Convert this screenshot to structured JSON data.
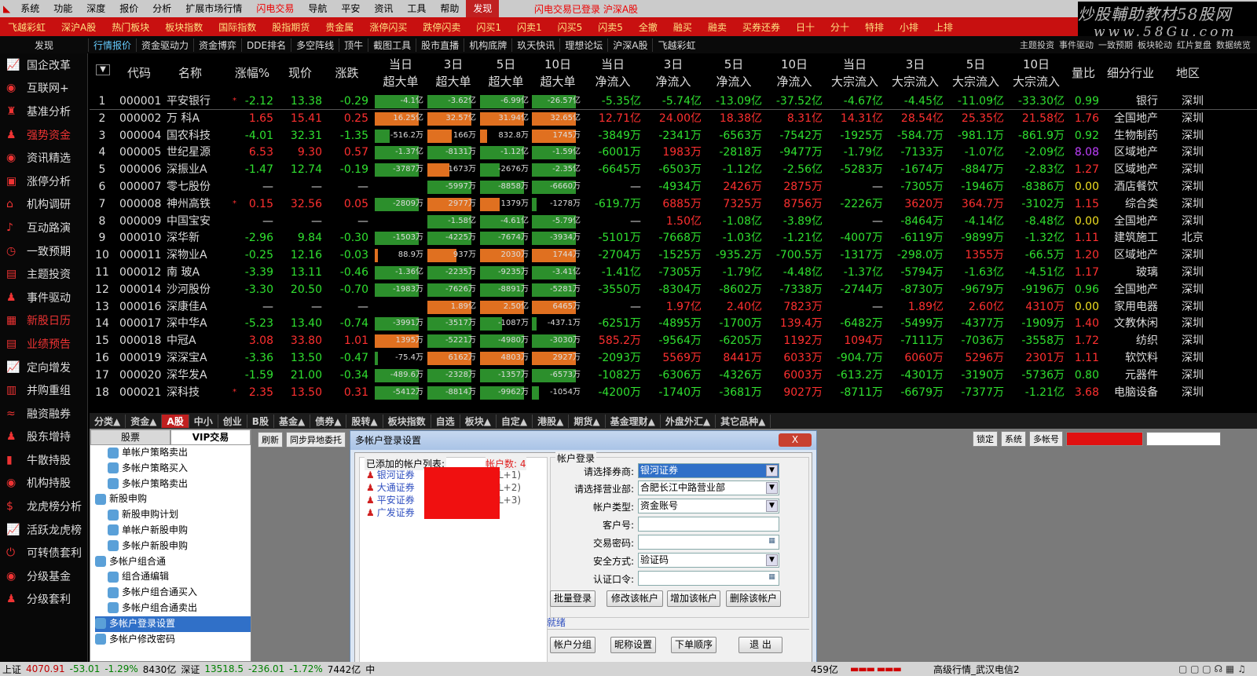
{
  "menu": [
    "系统",
    "功能",
    "深度",
    "报价",
    "分析",
    "扩展市场行情",
    "闪电交易",
    "导航",
    "平安",
    "资讯",
    "工具",
    "帮助",
    "发现"
  ],
  "menu_center": "闪电交易已登录  沪深A股",
  "logo": {
    "line1": "炒股輔助教材58股网",
    "line2": "www.58Gu.com"
  },
  "redbar": [
    "飞越彩虹",
    "深沪A股",
    "热门板块",
    "板块指数",
    "国际指数",
    "股指期货",
    "贵金属",
    "涨停闪买",
    "跌停闪卖",
    "闪买1",
    "闪卖1",
    "闪买5",
    "闪卖5",
    "全撤",
    "融买",
    "融卖",
    "买券还券",
    "日十",
    "分十",
    "特排",
    "小排",
    "上排"
  ],
  "subtab_first": "发现",
  "subtabs": [
    "行情报价",
    "资金驱动力",
    "资金博弈",
    "DDE排名",
    "多空阵线",
    "顶牛",
    "截图工具",
    "股市直播",
    "机构底牌",
    "玖天快讯",
    "理想论坛",
    "沪深A股",
    "飞越彩虹"
  ],
  "subtabs_right": [
    "主题投资",
    "事件驱动",
    "一致预期",
    "板块轮动",
    "红片复盘",
    "数据统览"
  ],
  "sidebar": [
    "国企改革",
    "互联网+",
    "基准分析",
    "强势资金",
    "资讯精选",
    "涨停分析",
    "机构调研",
    "互动路演",
    "一致预期",
    "主题投资",
    "事件驱动",
    "新股日历",
    "业绩预告",
    "定向增发",
    "并购重组",
    "融资融券",
    "股东增持",
    "牛散持股",
    "机构持股",
    "龙虎榜分析",
    "活跃龙虎榜",
    "可转债套利",
    "分级基金",
    "分级套利"
  ],
  "sidebar_icons": [
    "chart-icon",
    "globe-icon",
    "bell-icon",
    "person-icon",
    "globe-icon",
    "window-icon",
    "bank-icon",
    "mic-icon",
    "clock-icon",
    "doc-icon",
    "person-icon",
    "calendar-icon",
    "doc-icon",
    "chart-icon",
    "grid-icon",
    "wave-icon",
    "person-icon",
    "bars-icon",
    "globe-icon",
    "dollar-icon",
    "chart-icon",
    "power-icon",
    "globe-icon",
    "person-icon"
  ],
  "headers": {
    "code": "代码",
    "name": "名称",
    "pct": "涨幅%",
    "price": "现价",
    "chg": "涨跌",
    "h1a": "当日",
    "h1b": "超大单",
    "h2a": "3日",
    "h2b": "超大单",
    "h3a": "5日",
    "h3b": "超大单",
    "h4a": "10日",
    "h4b": "超大单",
    "h5a": "当日",
    "h5b": "净流入",
    "h6a": "3日",
    "h6b": "净流入",
    "h7a": "5日",
    "h7b": "净流入",
    "h8a": "10日",
    "h8b": "净流入",
    "h9a": "当日",
    "h9b": "大宗流入",
    "h10a": "3日",
    "h10b": "大宗流入",
    "h11a": "5日",
    "h11b": "大宗流入",
    "h12a": "10日",
    "h12b": "大宗流入",
    "lb": "量比",
    "ind": "细分行业",
    "reg": "地区"
  },
  "rows": [
    {
      "n": "1",
      "code": "000001",
      "name": "平安银行",
      "mark": "*",
      "pct": "-2.12",
      "price": "13.38",
      "chg": "-0.29",
      "b": [
        [
          "g",
          "-4.1亿",
          0.9
        ],
        [
          "g",
          "-3.62亿",
          0.9
        ],
        [
          "g",
          "-6.99亿",
          0.9
        ],
        [
          "g",
          "-26.57亿",
          0.9
        ]
      ],
      "f": [
        "-5.35亿",
        "-5.74亿",
        "-13.09亿",
        "-37.52亿",
        "-4.67亿",
        "-4.45亿",
        "-11.09亿",
        "-33.30亿"
      ],
      "lb": "0.99",
      "ind": "银行",
      "reg": "深圳"
    },
    {
      "n": "2",
      "code": "000002",
      "name": "万 科A",
      "mark": "",
      "pct": "1.65",
      "price": "15.41",
      "chg": "0.25",
      "b": [
        [
          "o",
          "16.25亿",
          0.9
        ],
        [
          "o",
          "32.57亿",
          0.9
        ],
        [
          "o",
          "31.94亿",
          0.9
        ],
        [
          "o",
          "32.65亿",
          0.9
        ]
      ],
      "f": [
        "12.71亿",
        "24.00亿",
        "18.38亿",
        "8.31亿",
        "14.31亿",
        "28.54亿",
        "25.35亿",
        "21.58亿"
      ],
      "lb": "1.76",
      "ind": "全国地产",
      "reg": "深圳"
    },
    {
      "n": "3",
      "code": "000004",
      "name": "国农科技",
      "mark": "",
      "pct": "-4.01",
      "price": "32.31",
      "chg": "-1.35",
      "b": [
        [
          "g",
          "-516.2万",
          0.3
        ],
        [
          "o",
          "166万",
          0.5
        ],
        [
          "o",
          "832.8万",
          0.15
        ],
        [
          "o",
          "1745万",
          0.9
        ]
      ],
      "f": [
        "-3849万",
        "-2341万",
        "-6563万",
        "-7542万",
        "-1925万",
        "-584.7万",
        "-981.1万",
        "-861.9万"
      ],
      "lb": "0.92",
      "ind": "生物制药",
      "reg": "深圳"
    },
    {
      "n": "4",
      "code": "000005",
      "name": "世纪星源",
      "mark": "",
      "pct": "6.53",
      "price": "9.30",
      "chg": "0.57",
      "b": [
        [
          "g",
          "-1.37亿",
          0.9
        ],
        [
          "g",
          "-8131万",
          0.9
        ],
        [
          "g",
          "-1.12亿",
          0.9
        ],
        [
          "g",
          "-1.59亿",
          0.9
        ]
      ],
      "f": [
        "-6001万",
        "1983万",
        "-2818万",
        "-9477万",
        "-1.79亿",
        "-7133万",
        "-1.07亿",
        "-2.09亿"
      ],
      "lb": "8.08",
      "ind": "区域地产",
      "reg": "深圳"
    },
    {
      "n": "5",
      "code": "000006",
      "name": "深振业A",
      "mark": "",
      "pct": "-1.47",
      "price": "12.74",
      "chg": "-0.19",
      "b": [
        [
          "g",
          "-3787万",
          0.9
        ],
        [
          "o",
          "1673万",
          0.45
        ],
        [
          "g",
          "-2676万",
          0.4
        ],
        [
          "g",
          "-2.35亿",
          0.9
        ]
      ],
      "f": [
        "-6645万",
        "-6503万",
        "-1.12亿",
        "-2.56亿",
        "-5283万",
        "-1674万",
        "-8847万",
        "-2.83亿"
      ],
      "lb": "1.27",
      "ind": "区域地产",
      "reg": "深圳"
    },
    {
      "n": "6",
      "code": "000007",
      "name": "零七股份",
      "mark": "",
      "pct": "—",
      "price": "—",
      "chg": "—",
      "b": [
        [
          "n",
          "",
          0
        ],
        [
          "g",
          "-5997万",
          0.9
        ],
        [
          "g",
          "-8858万",
          0.9
        ],
        [
          "g",
          "-6660万",
          0.9
        ]
      ],
      "f": [
        "—",
        "-4934万",
        "2426万",
        "2875万",
        "—",
        "-7305万",
        "-1946万",
        "-8386万"
      ],
      "lb": "0.00",
      "ind": "酒店餐饮",
      "reg": "深圳"
    },
    {
      "n": "7",
      "code": "000008",
      "name": "神州高铁",
      "mark": "*",
      "pct": "0.15",
      "price": "32.56",
      "chg": "0.05",
      "b": [
        [
          "g",
          "-2809万",
          0.9
        ],
        [
          "o",
          "2977万",
          0.9
        ],
        [
          "o",
          "1379万",
          0.4
        ],
        [
          "g",
          "-1278万",
          0.1
        ]
      ],
      "f": [
        "-619.7万",
        "6885万",
        "7325万",
        "8756万",
        "-2226万",
        "3620万",
        "364.7万",
        "-3102万"
      ],
      "lb": "1.15",
      "ind": "综合类",
      "reg": "深圳"
    },
    {
      "n": "8",
      "code": "000009",
      "name": "中国宝安",
      "mark": "",
      "pct": "—",
      "price": "—",
      "chg": "—",
      "b": [
        [
          "n",
          "",
          0
        ],
        [
          "g",
          "-1.58亿",
          0.9
        ],
        [
          "g",
          "-4.61亿",
          0.9
        ],
        [
          "g",
          "-5.79亿",
          0.9
        ]
      ],
      "f": [
        "—",
        "1.50亿",
        "-1.08亿",
        "-3.89亿",
        "—",
        "-8464万",
        "-4.14亿",
        "-8.48亿"
      ],
      "lb": "0.00",
      "ind": "全国地产",
      "reg": "深圳"
    },
    {
      "n": "9",
      "code": "000010",
      "name": "深华新",
      "mark": "",
      "pct": "-2.96",
      "price": "9.84",
      "chg": "-0.30",
      "b": [
        [
          "g",
          "-1503万",
          0.9
        ],
        [
          "g",
          "-4225万",
          0.9
        ],
        [
          "g",
          "-7674万",
          0.9
        ],
        [
          "g",
          "-3934万",
          0.9
        ]
      ],
      "f": [
        "-5101万",
        "-7668万",
        "-1.03亿",
        "-1.21亿",
        "-4007万",
        "-6119万",
        "-9899万",
        "-1.32亿"
      ],
      "lb": "1.11",
      "ind": "建筑施工",
      "reg": "北京"
    },
    {
      "n": "10",
      "code": "000011",
      "name": "深物业A",
      "mark": "",
      "pct": "-0.25",
      "price": "12.16",
      "chg": "-0.03",
      "b": [
        [
          "o",
          "88.9万",
          0.06
        ],
        [
          "o",
          "937万",
          0.6
        ],
        [
          "o",
          "2030万",
          0.9
        ],
        [
          "o",
          "1744万",
          0.9
        ]
      ],
      "f": [
        "-2704万",
        "-1525万",
        "-935.2万",
        "-700.5万",
        "-1317万",
        "-298.0万",
        "1355万",
        "-66.5万"
      ],
      "lb": "1.20",
      "ind": "区域地产",
      "reg": "深圳"
    },
    {
      "n": "11",
      "code": "000012",
      "name": "南 玻A",
      "mark": "",
      "pct": "-3.39",
      "price": "13.11",
      "chg": "-0.46",
      "b": [
        [
          "g",
          "-1.36亿",
          0.9
        ],
        [
          "g",
          "-2235万",
          0.9
        ],
        [
          "g",
          "-9235万",
          0.9
        ],
        [
          "g",
          "-3.41亿",
          0.9
        ]
      ],
      "f": [
        "-1.41亿",
        "-7305万",
        "-1.79亿",
        "-4.48亿",
        "-1.37亿",
        "-5794万",
        "-1.63亿",
        "-4.51亿"
      ],
      "lb": "1.17",
      "ind": "玻璃",
      "reg": "深圳"
    },
    {
      "n": "12",
      "code": "000014",
      "name": "沙河股份",
      "mark": "",
      "pct": "-3.30",
      "price": "20.50",
      "chg": "-0.70",
      "b": [
        [
          "g",
          "-1983万",
          0.9
        ],
        [
          "g",
          "-7626万",
          0.9
        ],
        [
          "g",
          "-8891万",
          0.9
        ],
        [
          "g",
          "-5281万",
          0.9
        ]
      ],
      "f": [
        "-3550万",
        "-8304万",
        "-8602万",
        "-7338万",
        "-2744万",
        "-8730万",
        "-9679万",
        "-9196万"
      ],
      "lb": "0.96",
      "ind": "全国地产",
      "reg": "深圳"
    },
    {
      "n": "13",
      "code": "000016",
      "name": "深康佳A",
      "mark": "",
      "pct": "—",
      "price": "—",
      "chg": "—",
      "b": [
        [
          "n",
          "",
          0
        ],
        [
          "o",
          "1.89亿",
          0.9
        ],
        [
          "o",
          "2.50亿",
          0.9
        ],
        [
          "o",
          "6465万",
          0.9
        ]
      ],
      "f": [
        "—",
        "1.97亿",
        "2.40亿",
        "7823万",
        "—",
        "1.89亿",
        "2.60亿",
        "4310万"
      ],
      "lb": "0.00",
      "ind": "家用电器",
      "reg": "深圳"
    },
    {
      "n": "14",
      "code": "000017",
      "name": "深中华A",
      "mark": "",
      "pct": "-5.23",
      "price": "13.40",
      "chg": "-0.74",
      "b": [
        [
          "g",
          "-3991万",
          0.9
        ],
        [
          "g",
          "-3517万",
          0.9
        ],
        [
          "g",
          "-1087万",
          0.45
        ],
        [
          "g",
          "-437.1万",
          0.1
        ]
      ],
      "f": [
        "-6251万",
        "-4895万",
        "-1700万",
        "139.4万",
        "-6482万",
        "-5499万",
        "-4377万",
        "-1909万"
      ],
      "lb": "1.40",
      "ind": "文教休闲",
      "reg": "深圳"
    },
    {
      "n": "15",
      "code": "000018",
      "name": "中冠A",
      "mark": "",
      "pct": "3.08",
      "price": "33.80",
      "chg": "1.01",
      "b": [
        [
          "o",
          "1395万",
          0.9
        ],
        [
          "g",
          "-5221万",
          0.9
        ],
        [
          "g",
          "-4980万",
          0.9
        ],
        [
          "g",
          "-3030万",
          0.9
        ]
      ],
      "f": [
        "585.2万",
        "-9564万",
        "-6205万",
        "1192万",
        "1094万",
        "-7111万",
        "-7036万",
        "-3558万"
      ],
      "lb": "1.72",
      "ind": "纺织",
      "reg": "深圳"
    },
    {
      "n": "16",
      "code": "000019",
      "name": "深深宝A",
      "mark": "",
      "pct": "-3.36",
      "price": "13.50",
      "chg": "-0.47",
      "b": [
        [
          "g",
          "-75.4万",
          0.05
        ],
        [
          "o",
          "6162万",
          0.9
        ],
        [
          "o",
          "4803万",
          0.9
        ],
        [
          "o",
          "2927万",
          0.9
        ]
      ],
      "f": [
        "-2093万",
        "5569万",
        "8441万",
        "6033万",
        "-904.7万",
        "6060万",
        "5296万",
        "2301万"
      ],
      "lb": "1.11",
      "ind": "软饮料",
      "reg": "深圳"
    },
    {
      "n": "17",
      "code": "000020",
      "name": "深华发A",
      "mark": "",
      "pct": "-1.59",
      "price": "21.00",
      "chg": "-0.34",
      "b": [
        [
          "g",
          "-489.6万",
          0.9
        ],
        [
          "g",
          "-2328万",
          0.9
        ],
        [
          "g",
          "-1357万",
          0.9
        ],
        [
          "g",
          "-6573万",
          0.9
        ]
      ],
      "f": [
        "-1082万",
        "-6306万",
        "-4326万",
        "6003万",
        "-613.2万",
        "-4301万",
        "-3190万",
        "-5736万"
      ],
      "lb": "0.80",
      "ind": "元器件",
      "reg": "深圳"
    },
    {
      "n": "18",
      "code": "000021",
      "name": "深科技",
      "mark": "*",
      "pct": "2.35",
      "price": "13.50",
      "chg": "0.31",
      "b": [
        [
          "g",
          "-5412万",
          0.9
        ],
        [
          "g",
          "-8814万",
          0.9
        ],
        [
          "g",
          "-9962万",
          0.9
        ],
        [
          "g",
          "-1054万",
          0.15
        ]
      ],
      "f": [
        "-4200万",
        "-1740万",
        "-3681万",
        "9027万",
        "-8711万",
        "-6679万",
        "-7377万",
        "-1.21亿"
      ],
      "lb": "3.68",
      "ind": "电脑设备",
      "reg": "深圳"
    }
  ],
  "btabs": [
    "分类▲",
    "资金▲",
    "A股",
    "中小",
    "创业",
    "B股",
    "基金▲",
    "债券▲",
    "股转▲",
    "板块指数",
    "自选",
    "板块▲",
    "自定▲",
    "港股▲",
    "期货▲",
    "基金理财▲",
    "外盘外汇▲",
    "其它品种▲"
  ],
  "tree_tabs": [
    "股票",
    "VIP交易"
  ],
  "tree": [
    [
      "c",
      "单帐户策略卖出"
    ],
    [
      "c",
      "多帐户策略买入"
    ],
    [
      "c",
      "多帐户策略卖出"
    ],
    [
      "p",
      "新股申购"
    ],
    [
      "c",
      "新股申购计划"
    ],
    [
      "c",
      "单帐户新股申购"
    ],
    [
      "c",
      "多帐户新股申购"
    ],
    [
      "p",
      "多帐户组合通"
    ],
    [
      "c",
      "组合通编辑"
    ],
    [
      "c",
      "多帐户组合通买入"
    ],
    [
      "c",
      "多帐户组合通卖出"
    ],
    [
      "s",
      "多帐户登录设置"
    ],
    [
      "p",
      "多帐户修改密码"
    ]
  ],
  "ltool": [
    "刷新",
    "同步异地委托"
  ],
  "rtool": [
    "锁定",
    "系统",
    "多帐号"
  ],
  "dialog": {
    "title": "多帐户登录设置",
    "close": "X",
    "list_label": "已添加的帐户列表:",
    "count": "帐户数: 4",
    "accounts": [
      "银河证券",
      "大通证券",
      "平安证券",
      "广发证券"
    ],
    "suffixes": [
      "L+1)",
      "L+2)",
      "L+3)"
    ],
    "login_legend": "帐户登录",
    "labels": [
      "请选择券商:",
      "请选择营业部:",
      "帐户类型:",
      "客户号:",
      "交易密码:",
      "安全方式:",
      "认证口令:"
    ],
    "broker": "银河证券",
    "branch": "合肥长江中路营业部",
    "acct_type": "资金账号",
    "client": "",
    "pwd": "",
    "security": "验证码",
    "token": "",
    "buttons1": [
      "批量登录",
      "修改该帐户",
      "增加该帐户",
      "删除该帐户"
    ],
    "status": "就绪",
    "buttons2": [
      "帐户分组",
      "昵称设置",
      "下单顺序",
      "退 出"
    ]
  },
  "status": {
    "sh": "上证",
    "sh_val": "4070.91",
    "sh_chg": "-53.01",
    "sh_pct": "-1.29%",
    "sh_amt": "8430亿",
    "sz": "深证",
    "sz_val": "13518.5",
    "sz_chg": "-236.01",
    "sz_pct": "-1.72%",
    "sz_amt": "7442亿",
    "mid": "中",
    "right_amt": "459亿",
    "right_text": "高级行情_武汉电信2"
  },
  "colors": {
    "up": "#ff3030",
    "down": "#30e030",
    "bar_green": "#2c8f2c",
    "bar_orange": "#e07020",
    "accent_red": "#c81010"
  }
}
